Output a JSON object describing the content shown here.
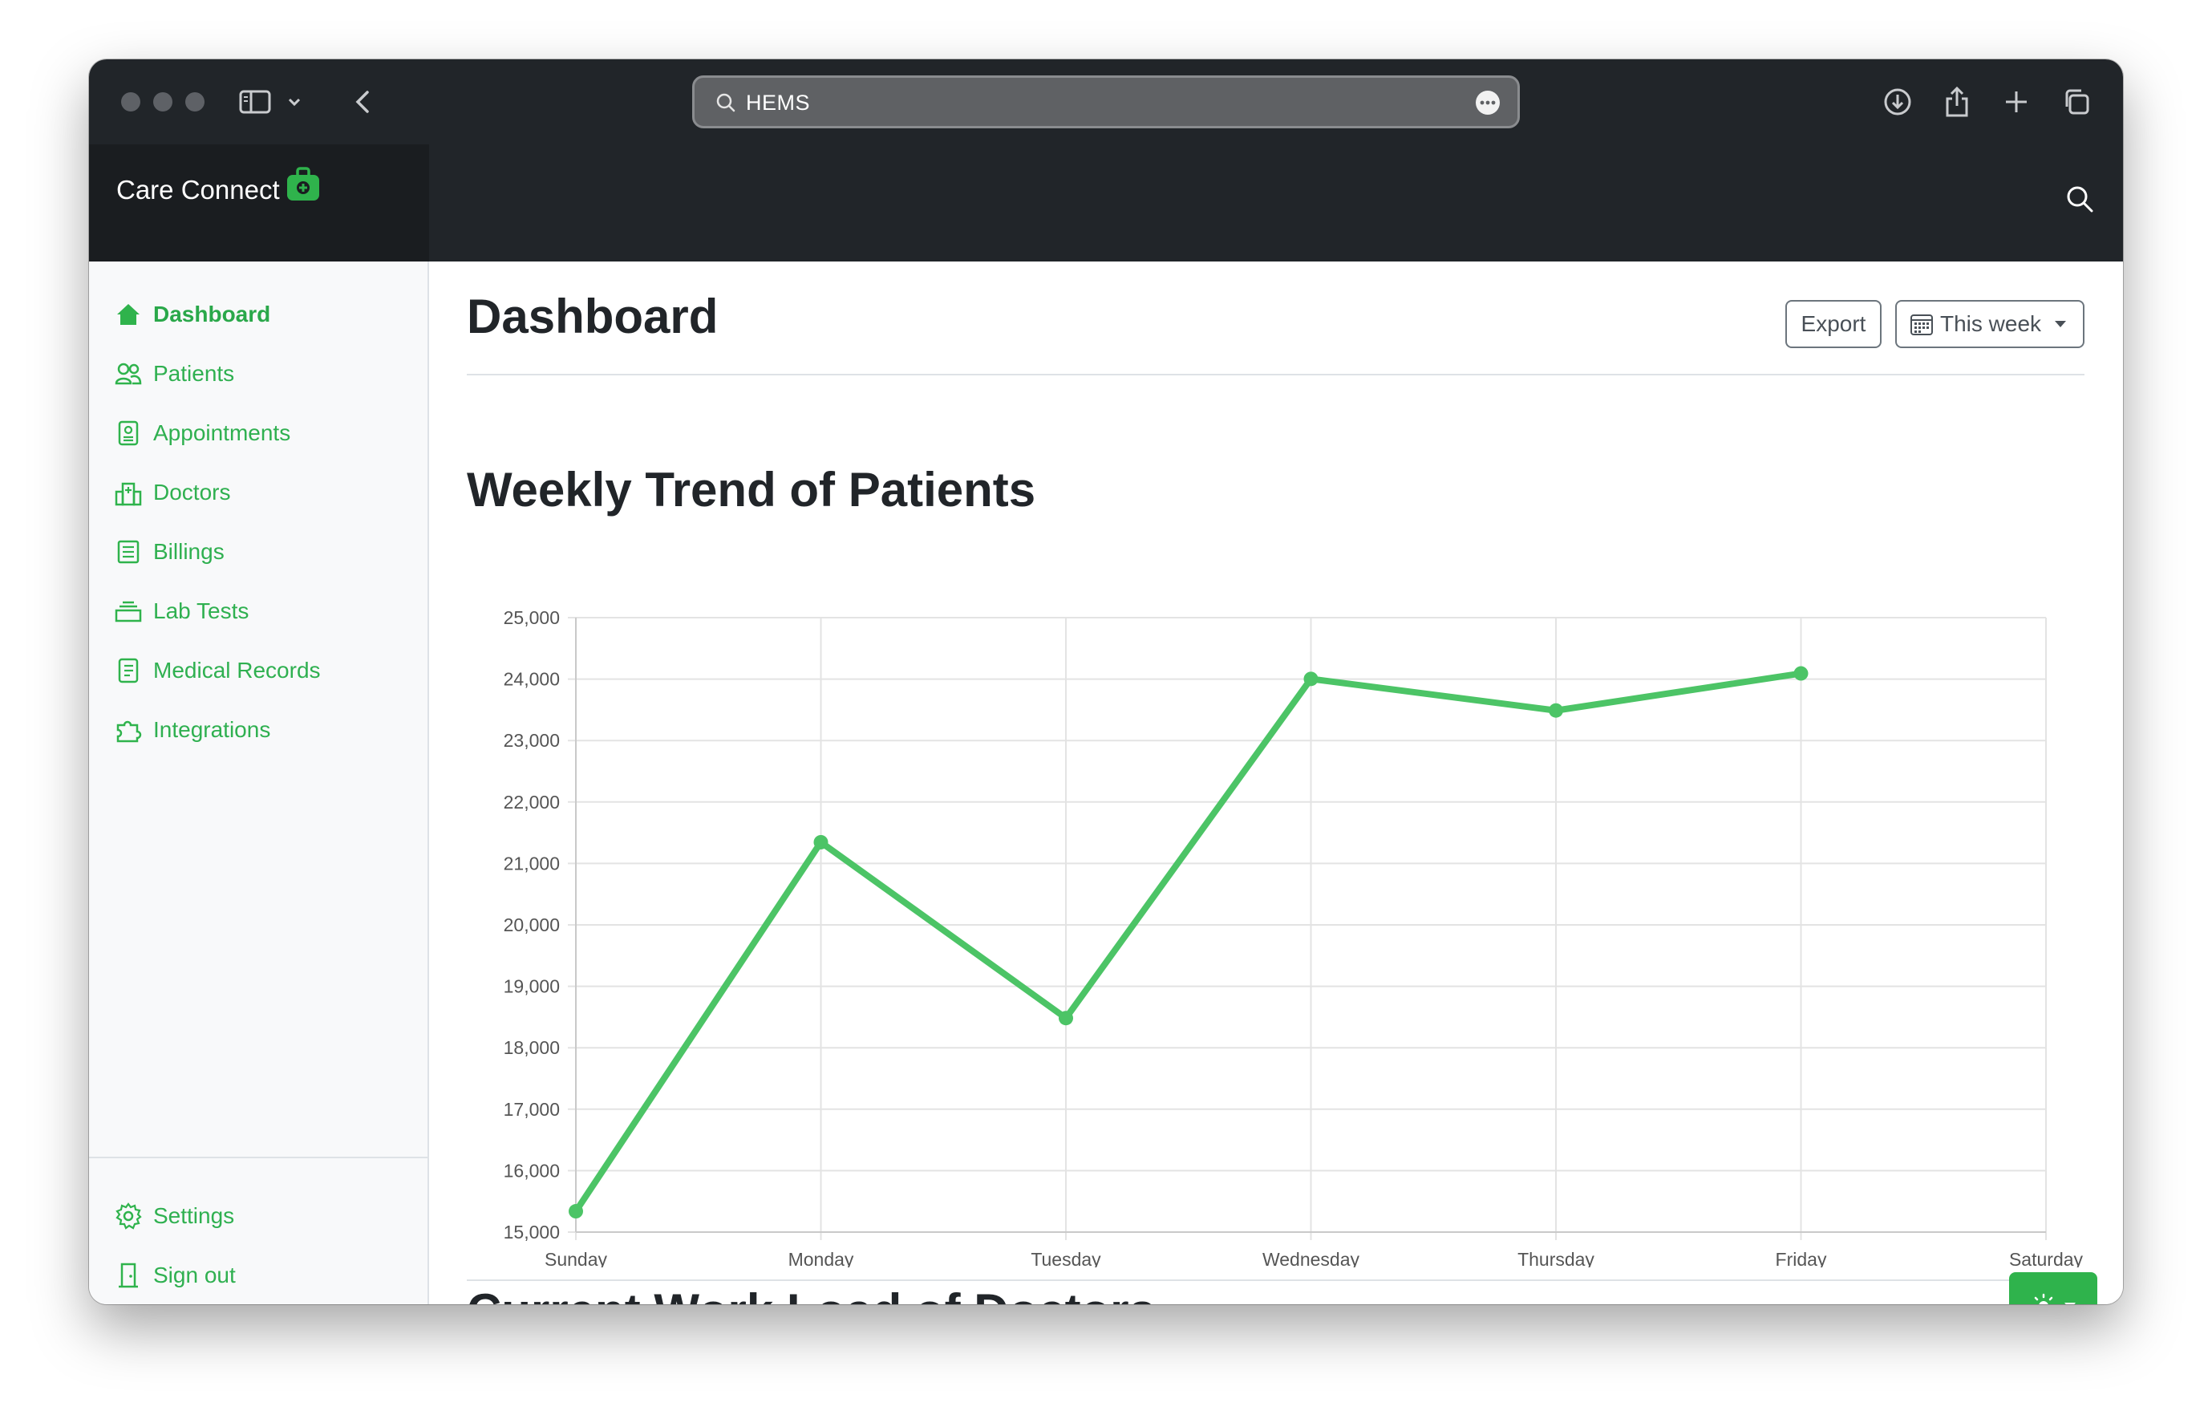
{
  "browser": {
    "address": "HEMS"
  },
  "app": {
    "brand": "Care Connect",
    "accent": "#2fb34c",
    "navbar_color": "#212529"
  },
  "sidebar": {
    "items": [
      {
        "label": "Dashboard",
        "icon": "house-icon",
        "active": true
      },
      {
        "label": "Patients",
        "icon": "people-icon"
      },
      {
        "label": "Appointments",
        "icon": "clipboard-person-icon"
      },
      {
        "label": "Doctors",
        "icon": "hospital-icon"
      },
      {
        "label": "Billings",
        "icon": "receipt-icon"
      },
      {
        "label": "Lab Tests",
        "icon": "tray-icon"
      },
      {
        "label": "Medical Records",
        "icon": "journal-text-icon"
      },
      {
        "label": "Integrations",
        "icon": "puzzle-icon"
      }
    ],
    "bottom": [
      {
        "label": "Settings",
        "icon": "gear-icon"
      },
      {
        "label": "Sign out",
        "icon": "door-icon"
      }
    ]
  },
  "main": {
    "title": "Dashboard",
    "export_label": "Export",
    "range_label": "This week",
    "chart_title": "Weekly Trend of Patients",
    "next_section_title": "Current Work Load of Doctors"
  },
  "chart_data": {
    "type": "line",
    "categories": [
      "Sunday",
      "Monday",
      "Tuesday",
      "Wednesday",
      "Thursday",
      "Friday",
      "Saturday"
    ],
    "series": [
      {
        "values": [
          15339,
          21345,
          18483,
          24003,
          23489,
          24092,
          null
        ],
        "color": "#4cc466"
      }
    ],
    "title": "",
    "xlabel": "",
    "ylabel": "",
    "ylim": [
      15000,
      25000
    ],
    "yticks": [
      15000,
      16000,
      17000,
      18000,
      19000,
      20000,
      21000,
      22000,
      23000,
      24000,
      25000
    ],
    "ytick_labels": [
      "15,000",
      "16,000",
      "17,000",
      "18,000",
      "19,000",
      "20,000",
      "21,000",
      "22,000",
      "23,000",
      "24,000",
      "25,000"
    ],
    "grid": true,
    "legend": "none"
  }
}
